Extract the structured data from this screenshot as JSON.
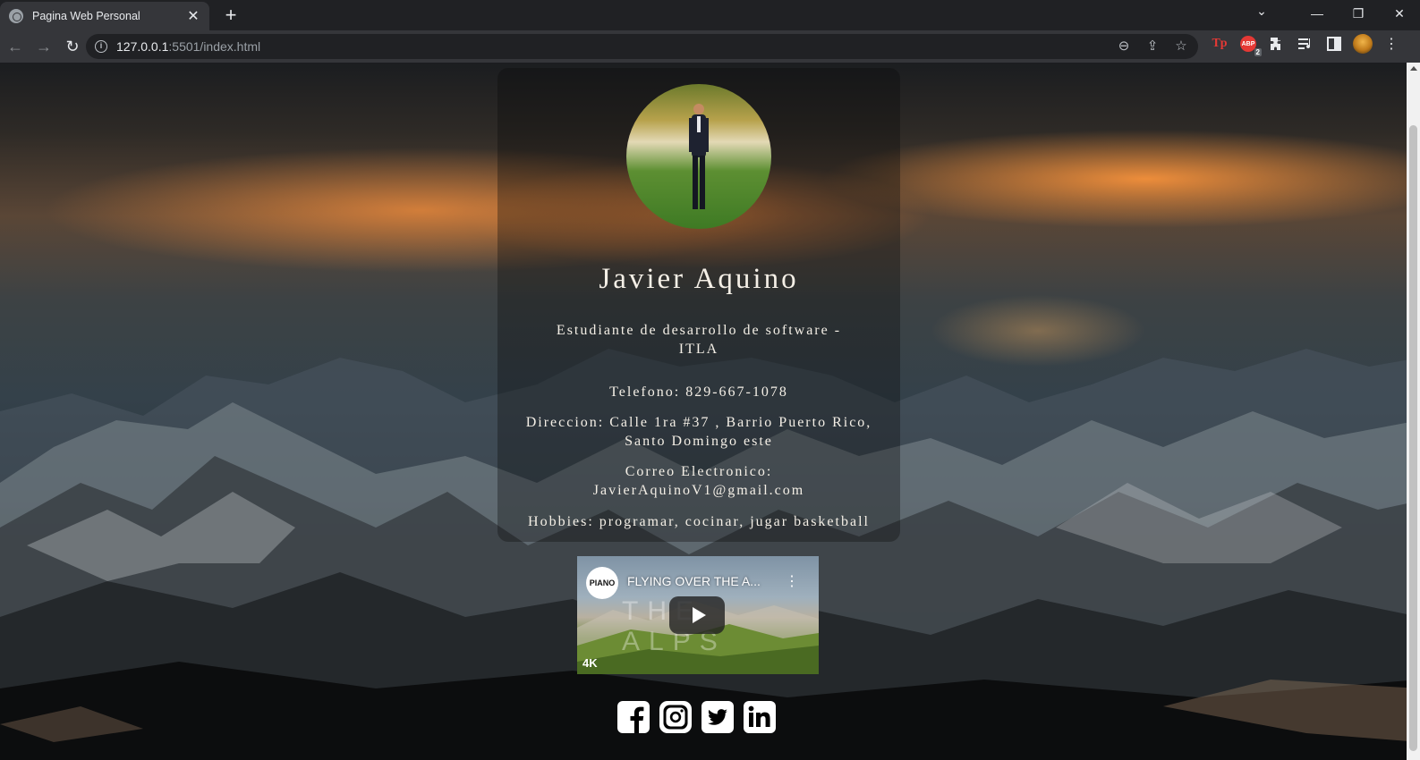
{
  "browser": {
    "tab_title": "Pagina Web Personal",
    "tab_close": "✕",
    "new_tab": "+",
    "url_host": "127.0.0.1",
    "url_rest": ":5501/index.html",
    "ext_tp": "Tp",
    "ext_abp": "ABP",
    "ext_abp_badge": "2"
  },
  "profile": {
    "name": "Javier Aquino",
    "subtitle": "Estudiante de desarrollo de software - ITLA",
    "phone": "Telefono: 829-667-1078",
    "address": "Direccion: Calle 1ra #37 , Barrio Puerto Rico, Santo Domingo este",
    "email_label": "Correo Electronico:",
    "email": "JavierAquinoV1@gmail.com",
    "hobbies": "Hobbies: programar, cocinar, jugar basketball"
  },
  "video": {
    "channel_logo": "PIANO",
    "title": "FLYING OVER THE A...",
    "overlay_text": "THE ALPS",
    "quality": "4K"
  },
  "social": [
    "facebook-icon",
    "instagram-icon",
    "twitter-icon",
    "linkedin-icon"
  ]
}
